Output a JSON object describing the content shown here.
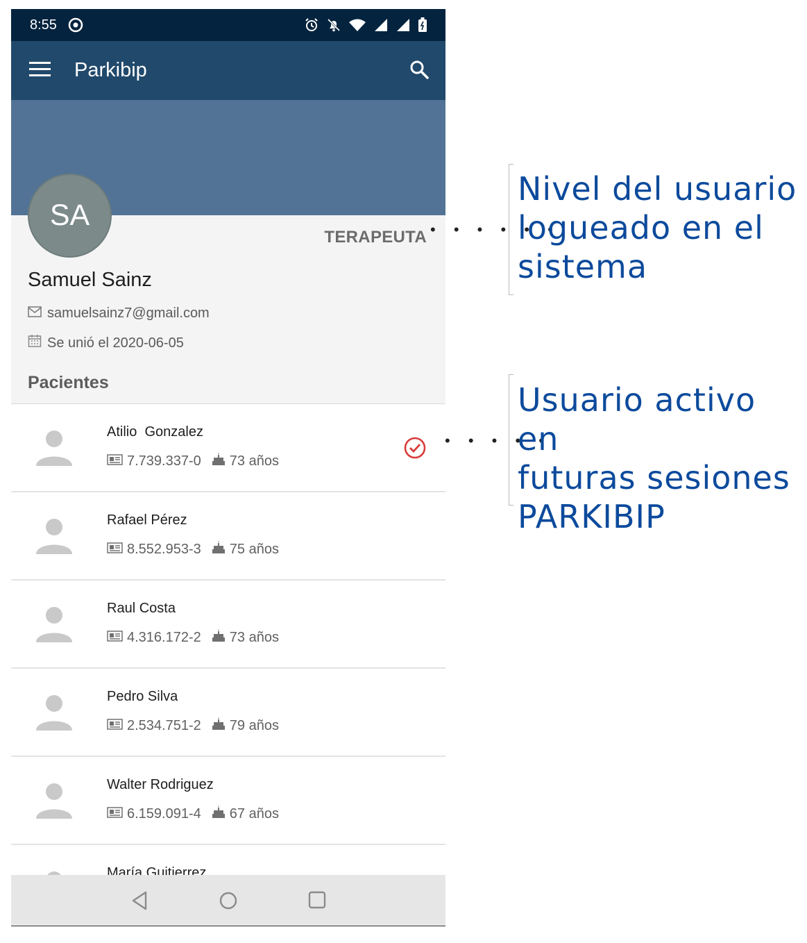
{
  "status_bar": {
    "time": "8:55"
  },
  "app_bar": {
    "title": "Parkibip"
  },
  "profile": {
    "initials": "SA",
    "role": "TERAPEUTA",
    "name": "Samuel Sainz",
    "email": "samuelsainz7@gmail.com",
    "joined": "Se unió el 2020-06-05"
  },
  "patients_section": {
    "title": "Pacientes"
  },
  "patients": [
    {
      "name": "Atilio  Gonzalez",
      "id": "7.739.337-0",
      "age": "73 años",
      "active": true
    },
    {
      "name": "Rafael Pérez",
      "id": "8.552.953-3",
      "age": "75 años",
      "active": false
    },
    {
      "name": "Raul Costa",
      "id": "4.316.172-2",
      "age": "73 años",
      "active": false
    },
    {
      "name": "Pedro Silva",
      "id": "2.534.751-2",
      "age": "79 años",
      "active": false
    },
    {
      "name": "Walter Rodriguez",
      "id": "6.159.091-4",
      "age": "67 años",
      "active": false
    },
    {
      "name": "María Guitierrez",
      "id": "",
      "age": "",
      "active": false
    }
  ],
  "annotations": {
    "level": [
      "Nivel del usuario",
      "logueado en el",
      "sistema"
    ],
    "active": [
      "Usuario activo en",
      "futuras sesiones",
      "PARKIBIP"
    ]
  },
  "icons": {
    "status": [
      "chrome-icon",
      "alarm-icon",
      "bell-off-icon",
      "wifi-icon",
      "signal-icon",
      "battery-icon"
    ],
    "app_bar": [
      "menu-icon",
      "search-icon"
    ],
    "nav": [
      "back-icon",
      "home-icon",
      "recents-icon"
    ],
    "profile": [
      "mail-icon",
      "calendar-icon"
    ],
    "patient": [
      "person-icon",
      "id-card-icon",
      "cake-icon",
      "check-circle-icon"
    ]
  },
  "colors": {
    "status_bar": "#04233e",
    "app_bar": "#21496b",
    "banner": "#527395",
    "active_check": "#d93b3b",
    "annotation": "#0c4a9c"
  }
}
